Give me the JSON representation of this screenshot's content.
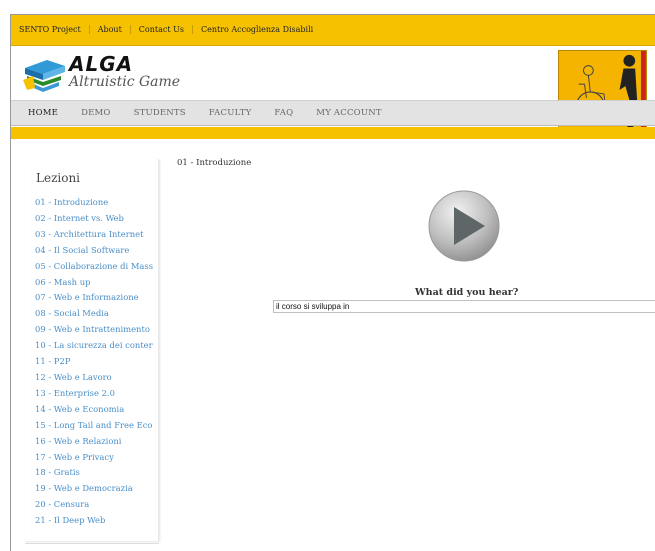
{
  "topbar": {
    "links": [
      "SENTO Project",
      "About",
      "Contact Us",
      "Centro Accoglienza Disabili"
    ]
  },
  "header": {
    "logo_title": "ALGA",
    "logo_subtitle": "Altruistic Game"
  },
  "nav": {
    "items": [
      "HOME",
      "DEMO",
      "STUDENTS",
      "FACULTY",
      "FAQ",
      "MY ACCOUNT"
    ],
    "active": "HOME"
  },
  "sidebar": {
    "title": "Lezioni",
    "items": [
      "01 - Introduzione",
      "02 - Internet vs. Web",
      "03 - Architettura Internet",
      "04 - Il Social Software",
      "05 - Collaborazione di Mass",
      "06 - Mash up",
      "07 - Web e Informazione",
      "08 - Social Media",
      "09 - Web e Intrattenimento",
      "10 - La sicurezza dei conter",
      "11 - P2P",
      "12 - Web e Lavoro",
      "13 - Enterprise 2.0",
      "14 - Web e Economia",
      "15 - Long Tail and Free Eco",
      "16 - Web e Relazioni",
      "17 - Web e Privacy",
      "18 - Gratis",
      "19 - Web e Democrazia",
      "20 - Censura",
      "21 - Il Deep Web"
    ]
  },
  "main": {
    "title": "01 - Introduzione",
    "question": "What did you hear?",
    "answer_value": "il corso si sviluppa in"
  },
  "colors": {
    "accent_yellow": "#f6c200",
    "link_blue": "#4a8fc8",
    "nav_bg": "#e3e3e3"
  },
  "icons": {
    "play": "play-button-icon",
    "logo": "books-logo-icon"
  }
}
